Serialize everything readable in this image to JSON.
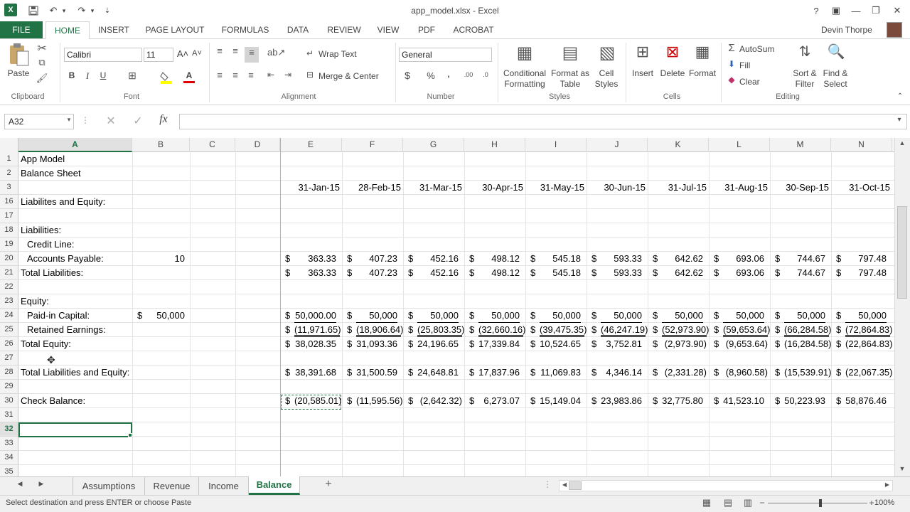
{
  "window": {
    "title": "app_model.xlsx - Excel",
    "user": "Devin Thorpe",
    "help": "?",
    "minimize": "—",
    "restore": "❐",
    "close": "✕",
    "ribbon_display": "▣"
  },
  "qat": {
    "app_icon": "X",
    "save": "💾",
    "undo": "↶",
    "undo_drop": "▾",
    "redo": "↷",
    "redo_drop": "▾",
    "customize": "⇣"
  },
  "ribbon_tabs": [
    "FILE",
    "HOME",
    "INSERT",
    "PAGE LAYOUT",
    "FORMULAS",
    "DATA",
    "REVIEW",
    "VIEW",
    "PDF",
    "ACROBAT"
  ],
  "ribbon": {
    "clipboard": {
      "paste": "Paste",
      "label": "Clipboard"
    },
    "font": {
      "name": "Calibri",
      "size": "11",
      "grow": "A˄",
      "shrink": "A˅",
      "bold": "B",
      "italic": "I",
      "underline": "U",
      "label": "Font",
      "font_color": "A"
    },
    "alignment": {
      "wrap": "Wrap Text",
      "merge": "Merge & Center",
      "label": "Alignment"
    },
    "number": {
      "format": "General",
      "currency": "$",
      "percent": "%",
      "comma": ",",
      "label": "Number"
    },
    "styles": {
      "cond1": "Conditional",
      "cond2": "Formatting",
      "fmt1": "Format as",
      "fmt2": "Table",
      "cell1": "Cell",
      "cell2": "Styles",
      "label": "Styles"
    },
    "cells": {
      "insert": "Insert",
      "delete": "Delete",
      "format": "Format",
      "label": "Cells"
    },
    "editing": {
      "autosum": "AutoSum",
      "fill": "Fill",
      "clear": "Clear",
      "sort1": "Sort &",
      "sort2": "Filter",
      "find1": "Find &",
      "find2": "Select",
      "label": "Editing"
    }
  },
  "formula_bar": {
    "name_box": "A32",
    "fx": "fx",
    "cancel": "✕",
    "enter": "✓",
    "value": ""
  },
  "columns": [
    "A",
    "B",
    "C",
    "D",
    "E",
    "F",
    "G",
    "H",
    "I",
    "J",
    "K",
    "L",
    "M",
    "N"
  ],
  "rows": [
    {
      "n": "1",
      "a": "App Model",
      "b": "",
      "v": []
    },
    {
      "n": "2",
      "a": "Balance Sheet",
      "b": "",
      "v": []
    },
    {
      "n": "3",
      "a": "",
      "b": "",
      "dates": [
        "31-Jan-15",
        "28-Feb-15",
        "31-Mar-15",
        "30-Apr-15",
        "31-May-15",
        "30-Jun-15",
        "31-Jul-15",
        "31-Aug-15",
        "30-Sep-15",
        "31-Oct-15"
      ]
    },
    {
      "n": "16",
      "a": "Liabilites and Equity:",
      "b": "",
      "v": []
    },
    {
      "n": "17",
      "a": "",
      "b": "",
      "v": []
    },
    {
      "n": "18",
      "a": "Liabilities:",
      "b": "",
      "v": []
    },
    {
      "n": "19",
      "a": "  Credit Line:",
      "b": "",
      "v": []
    },
    {
      "n": "20",
      "a": "  Accounts Payable:",
      "b": "10",
      "v": [
        "363.33",
        "407.23",
        "452.16",
        "498.12",
        "545.18",
        "593.33",
        "642.62",
        "693.06",
        "744.67",
        "797.48"
      ]
    },
    {
      "n": "21",
      "a": "Total Liabilities:",
      "b": "",
      "v": [
        "363.33",
        "407.23",
        "452.16",
        "498.12",
        "545.18",
        "593.33",
        "642.62",
        "693.06",
        "744.67",
        "797.48"
      ]
    },
    {
      "n": "22",
      "a": "",
      "b": "",
      "v": []
    },
    {
      "n": "23",
      "a": "Equity:",
      "b": "",
      "v": []
    },
    {
      "n": "24",
      "a": "  Paid-in Capital:",
      "b": "50,000",
      "b_cur": "$",
      "v": [
        "50,000.00",
        "50,000",
        "50,000",
        "50,000",
        "50,000",
        "50,000",
        "50,000",
        "50,000",
        "50,000",
        "50,000"
      ]
    },
    {
      "n": "25",
      "a": "  Retained Earnings:",
      "b": "",
      "v": [
        "(11,971.65)",
        "(18,906.64)",
        "(25,803.35)",
        "(32,660.16)",
        "(39,475.35)",
        "(46,247.19)",
        "(52,973.90)",
        "(59,653.64)",
        "(66,284.58)",
        "(72,864.83)"
      ]
    },
    {
      "n": "26",
      "a": "Total Equity:",
      "b": "",
      "v": [
        "38,028.35",
        "31,093.36",
        "24,196.65",
        "17,339.84",
        "10,524.65",
        "3,752.81",
        "(2,973.90)",
        "(9,653.64)",
        "(16,284.58)",
        "(22,864.83)"
      ]
    },
    {
      "n": "27",
      "a": "",
      "b": "",
      "v": []
    },
    {
      "n": "28",
      "a": "Total Liabilities and Equity:",
      "b": "",
      "v": [
        "38,391.68",
        "31,500.59",
        "24,648.81",
        "17,837.96",
        "11,069.83",
        "4,346.14",
        "(2,331.28)",
        "(8,960.58)",
        "(15,539.91)",
        "(22,067.35)"
      ]
    },
    {
      "n": "29",
      "a": "",
      "b": "",
      "v": []
    },
    {
      "n": "30",
      "a": "Check Balance:",
      "b": "",
      "v": [
        "(20,585.01)",
        "(11,595.56)",
        "(2,642.32)",
        "6,273.07",
        "15,149.04",
        "23,983.86",
        "32,775.80",
        "41,523.10",
        "50,223.93",
        "58,876.46"
      ]
    },
    {
      "n": "31",
      "a": "",
      "b": "",
      "v": []
    },
    {
      "n": "32",
      "a": "",
      "b": "",
      "v": []
    },
    {
      "n": "33",
      "a": "",
      "b": "",
      "v": []
    },
    {
      "n": "34",
      "a": "",
      "b": "",
      "v": []
    },
    {
      "n": "35",
      "a": "",
      "b": "",
      "v": []
    }
  ],
  "currency_symbol": "$",
  "sheet_tabs": [
    "Assumptions",
    "Revenue",
    "Income",
    "Balance"
  ],
  "active_sheet": "Balance",
  "add_sheet": "+",
  "status": {
    "message": "Select destination and press ENTER or choose Paste",
    "zoom": "100%"
  },
  "colors": {
    "accent": "#217346"
  }
}
